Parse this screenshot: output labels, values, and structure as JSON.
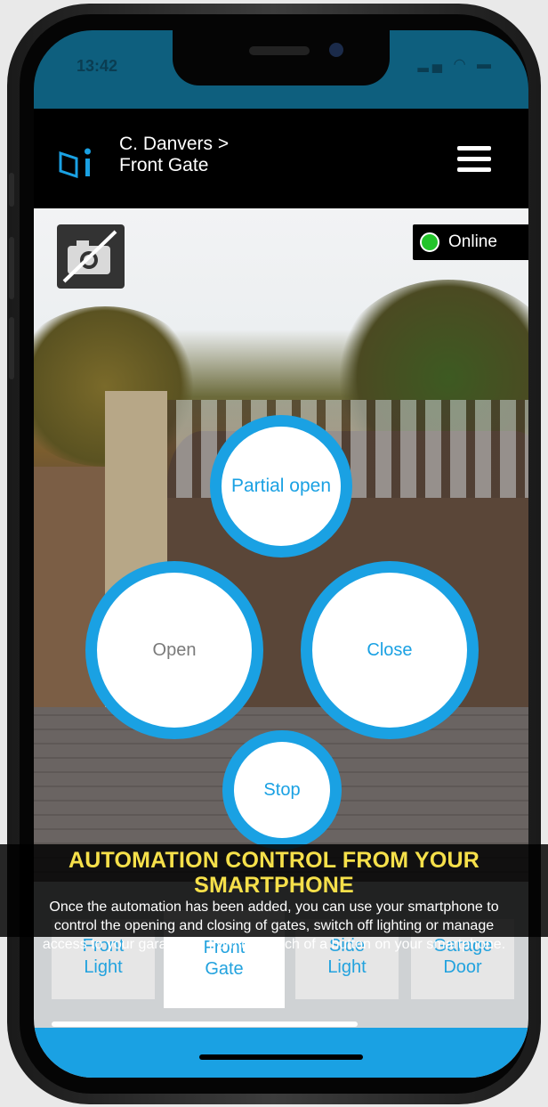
{
  "status_bar": {
    "time": "13:42",
    "icons": [
      "signal-icon",
      "wifi-icon",
      "battery-icon"
    ]
  },
  "header": {
    "breadcrumb_line1": "C. Danvers >",
    "breadcrumb_line2": "Front Gate",
    "logo": "app-logo-icon",
    "menu_icon": "hamburger-menu-icon"
  },
  "camera": {
    "toggle_icon": "camera-off-icon",
    "status": "Online",
    "status_color": "#22c42a"
  },
  "controls": {
    "partial_open": "Partial open",
    "open": "Open",
    "close": "Close",
    "stop": "Stop",
    "accent": "#1aa1e3"
  },
  "nav": {
    "items": [
      {
        "line1": "Front",
        "line2": "Light"
      },
      {
        "line1": "Front",
        "line2": "Gate"
      },
      {
        "line1": "Side",
        "line2": "Light"
      },
      {
        "line1": "Garage",
        "line2": "Door"
      }
    ],
    "active_index": 1
  },
  "caption": {
    "title": "AUTOMATION CONTROL FROM YOUR SMARTPHONE",
    "line1": "Once the automation has been added, you can use your smartphone to",
    "line2": "control the opening and closing of gates, switch off lighting or manage",
    "line3": "access to your garage, all from the touch of a button on your smartphone."
  }
}
